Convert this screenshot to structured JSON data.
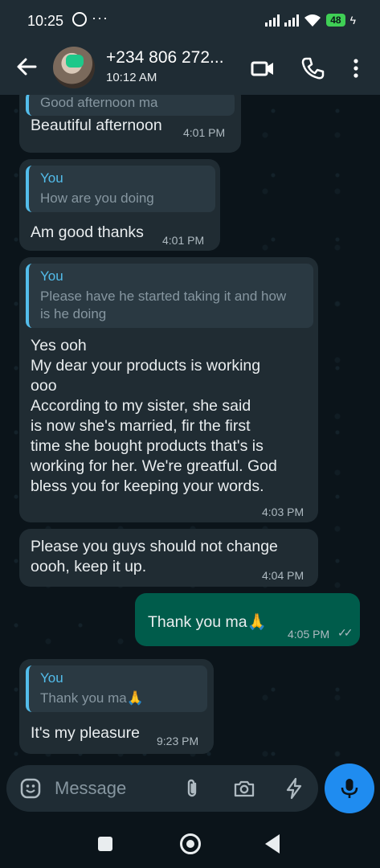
{
  "status_bar": {
    "time": "10:25",
    "dots": "···",
    "battery": "48",
    "colors": {
      "battery": "#3fcf55"
    }
  },
  "header": {
    "contact_name": "+234 806 272...",
    "contact_status": "10:12 AM",
    "icons": [
      "back-arrow-icon",
      "video-call-icon",
      "phone-call-icon",
      "more-options-icon"
    ]
  },
  "messages": [
    {
      "type": "incoming",
      "quote_text": "Good afternoon ma",
      "text": "Beautiful afternoon",
      "time": "4:01 PM"
    },
    {
      "type": "incoming",
      "quote_author": "You",
      "quote_text": "How are you doing",
      "text": "Am good thanks",
      "time": "4:01 PM"
    },
    {
      "type": "incoming",
      "quote_author": "You",
      "quote_text": "Please have he started taking it and how\nis he doing",
      "text": "Yes ooh\nMy dear your products is working\nooo\nAccording to my sister,  she said\nis now she's married,  fir the first\ntime she bought products that's  is\nworking for her. We're greatful.  God\nbless you for keeping your words.",
      "time": "4:03 PM"
    },
    {
      "type": "incoming",
      "text": "Please you guys should not change\noooh, keep it up.",
      "time": "4:04 PM"
    },
    {
      "type": "outgoing",
      "text": "Thank you ma🙏",
      "time": "4:05 PM",
      "ticks": "✓✓"
    },
    {
      "type": "incoming",
      "quote_author": "You",
      "quote_text": "Thank you ma🙏",
      "text": "It's my pleasure",
      "time": "9:23 PM"
    }
  ],
  "input": {
    "placeholder": "Message",
    "icons": [
      "emoji-icon",
      "attach-icon",
      "camera-icon",
      "bolt-icon",
      "mic-icon"
    ]
  },
  "colors": {
    "chat_bg": "#0b141a",
    "incoming_bubble": "#202c33",
    "outgoing_bubble": "#005c4b",
    "quote_accent": "#53bdeb",
    "mic_button": "#1f8cf0"
  }
}
